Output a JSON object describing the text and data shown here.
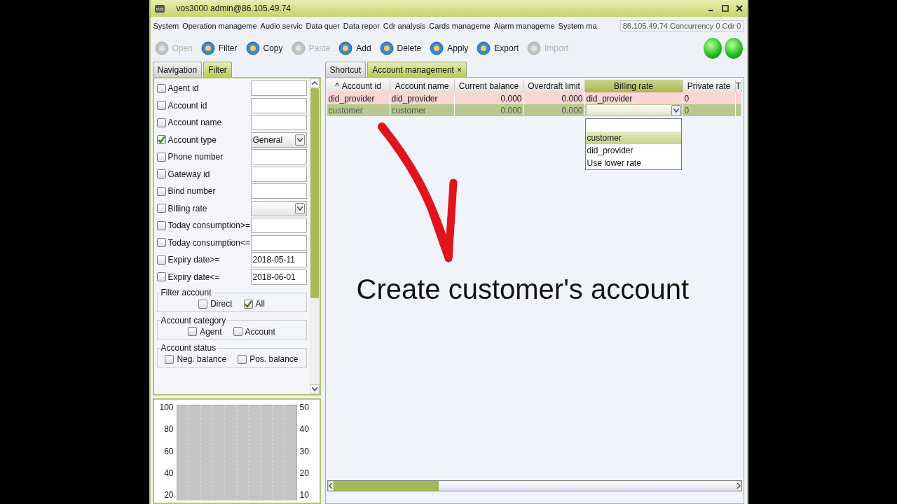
{
  "window": {
    "title": "vos3000 admin@86.105.49.74",
    "app_badge": "vos"
  },
  "menu": [
    "System",
    "Operation manageme",
    "Audio servic",
    "Data quer",
    "Data repor",
    "Cdr analysis",
    "Cards manageme",
    "Alarm manageme",
    "System ma"
  ],
  "status_info": "86.105.49.74  Concurrency 0  Cdr 0",
  "toolbar": [
    {
      "label": "Open",
      "disabled": true
    },
    {
      "label": "Filter",
      "disabled": false
    },
    {
      "label": "Copy",
      "disabled": false
    },
    {
      "label": "Paste",
      "disabled": true
    },
    {
      "label": "Add",
      "disabled": false
    },
    {
      "label": "Delete",
      "disabled": false
    },
    {
      "label": "Apply",
      "disabled": false
    },
    {
      "label": "Export",
      "disabled": false
    },
    {
      "label": "Import",
      "disabled": true
    }
  ],
  "left_tabs": [
    {
      "label": "Navigation",
      "selected": false
    },
    {
      "label": "Filter",
      "selected": true
    }
  ],
  "filters": [
    {
      "label": "Agent id",
      "checked": false,
      "kind": "text"
    },
    {
      "label": "Account id",
      "checked": false,
      "kind": "text"
    },
    {
      "label": "Account name",
      "checked": false,
      "kind": "text"
    },
    {
      "label": "Account type",
      "checked": true,
      "kind": "select",
      "value": "General"
    },
    {
      "label": "Phone number",
      "checked": false,
      "kind": "text"
    },
    {
      "label": "Gateway id",
      "checked": false,
      "kind": "text"
    },
    {
      "label": "Bind number",
      "checked": false,
      "kind": "text"
    },
    {
      "label": "Billing rate",
      "checked": false,
      "kind": "select"
    },
    {
      "label": "Today consumption>=",
      "checked": false,
      "kind": "text"
    },
    {
      "label": "Today consumption<=",
      "checked": false,
      "kind": "text"
    },
    {
      "label": "Expiry date>=",
      "checked": false,
      "kind": "text",
      "value": "2018-05-11"
    },
    {
      "label": "Expiry date<=",
      "checked": false,
      "kind": "text",
      "value": "2018-06-01"
    }
  ],
  "filter_groups": [
    {
      "title": "Filter account",
      "options": [
        {
          "label": "Direct",
          "checked": false
        },
        {
          "label": "All",
          "checked": true
        }
      ]
    },
    {
      "title": "Account category",
      "options": [
        {
          "label": "Agent",
          "checked": false
        },
        {
          "label": "Account",
          "checked": false
        }
      ]
    },
    {
      "title": "Account status",
      "options": [
        {
          "label": "Neg. balance",
          "checked": false
        },
        {
          "label": "Pos. balance",
          "checked": false
        }
      ]
    }
  ],
  "chart": {
    "left_ticks": [
      "100",
      "80",
      "60",
      "40",
      "20"
    ],
    "right_ticks": [
      "50",
      "40",
      "30",
      "20",
      "10"
    ]
  },
  "right_tabs": [
    {
      "label": "Shortcut",
      "selected": false
    },
    {
      "label": "Account management",
      "selected": true,
      "close": "×"
    }
  ],
  "table": {
    "sort_mark": "^",
    "columns": [
      "Account id",
      "Account name",
      "Current balance",
      "Overdraft limit",
      "Billing rate",
      "Private rate",
      "T"
    ],
    "rows": [
      {
        "selected": false,
        "cells": [
          "did_provider",
          "did_provider",
          "0.000",
          "0.000",
          "did_provider",
          "0",
          ""
        ]
      },
      {
        "selected": true,
        "cells": [
          "customer",
          "customer",
          "0.000",
          "0.000",
          "",
          "0",
          ""
        ]
      }
    ]
  },
  "dropdown": {
    "options": [
      {
        "label": "customer",
        "selected": true
      },
      {
        "label": "did_provider",
        "selected": false
      },
      {
        "label": "Use lower rate",
        "selected": false
      }
    ]
  },
  "caption": "Create customer's account"
}
